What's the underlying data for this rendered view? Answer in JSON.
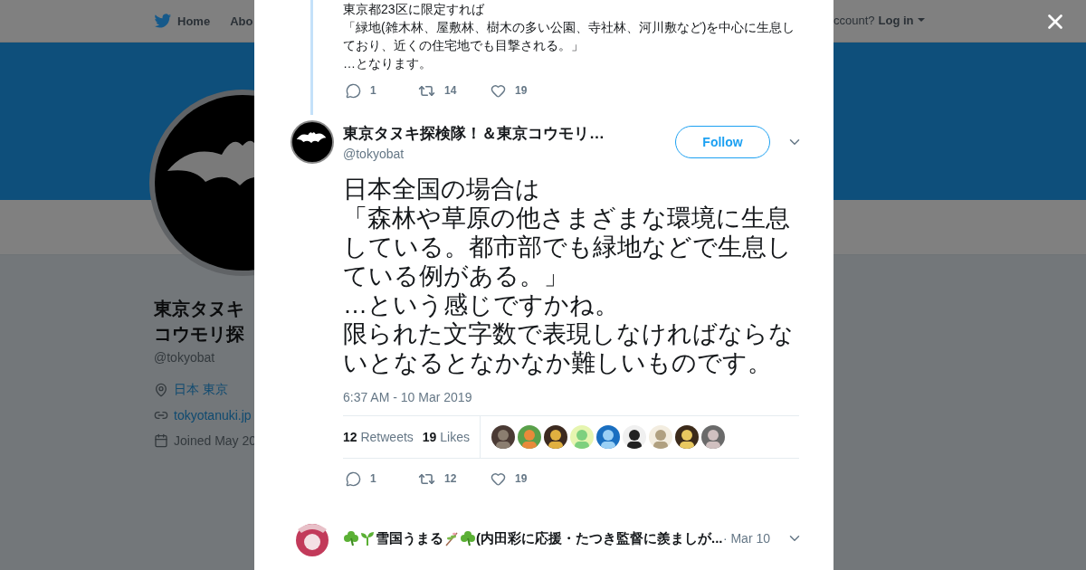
{
  "nav": {
    "home": "Home",
    "about": "Abo",
    "login_prompt": "ccount?",
    "login": "Log in"
  },
  "profile": {
    "name_lines": [
      "東京タヌキ",
      "コウモリ探"
    ],
    "handle": "@tokyobat",
    "location": "日本 東京",
    "website": "tokyotanuki.jp",
    "joined": "Joined May 20"
  },
  "previous_tweet": {
    "paragraphs": [
      "東京都23区に限定すれば",
      "「緑地(雑木林、屋敷林、樹木の多い公園、寺社林、河川敷など)を中心に生息しており、近くの住宅地でも目撃される。」",
      "…となります。"
    ],
    "replies": "1",
    "retweets": "14",
    "likes": "19"
  },
  "tweet": {
    "name": "東京タヌキ探検隊！＆東京コウモリ…",
    "handle": "@tokyobat",
    "follow": "Follow",
    "paragraphs": [
      "日本全国の場合は",
      "「森林や草原の他さまざまな環境に生息している。都市部でも緑地などで生息している例がある。」",
      "…という感じですかね。",
      "限られた文字数で表現しなければならないとなるとなかなか難しいものです。"
    ],
    "timestamp": "6:37 AM - 10 Mar 2019",
    "retweet_count": "12",
    "retweet_label": "Retweets",
    "like_count": "19",
    "like_label": "Likes",
    "replies": "1",
    "retweets": "12",
    "likes": "19"
  },
  "next_tweet": {
    "name_parts": [
      {
        "kind": "clover"
      },
      {
        "kind": "sprout"
      },
      {
        "kind": "text",
        "text": "雪国うまる"
      },
      {
        "kind": "herb"
      },
      {
        "kind": "clover"
      },
      {
        "kind": "text",
        "text": "(内田彩に応援・たつき監督に羨ましが..."
      }
    ],
    "date": "· Mar 10"
  }
}
